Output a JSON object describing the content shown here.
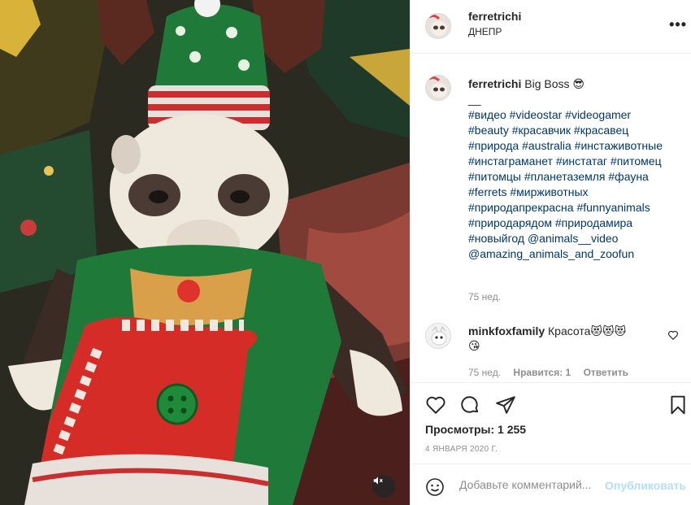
{
  "media": {
    "type": "video",
    "mute_icon": "speaker-muted-icon"
  },
  "header": {
    "username": "ferretrichi",
    "location": "ДНЕПР",
    "more_icon": "more-horizontal-icon"
  },
  "caption": {
    "username": "ferretrichi",
    "lines": [
      "Big Boss 😎",
      "__",
      "#видео #videostar #videogamer",
      "#beauty #красавчик #красавец",
      "#природа #australia #инстаживотные",
      "#инстаграманет #инстатаг #питомец",
      "#питомцы #планетаземля #фауна",
      "#ferrets #мирживотных",
      "#природапрекрасна #funnyanimals",
      "#природарядом #природамира",
      "#новыйгод @animals__video",
      "@amazing_animals_and_zoofun"
    ],
    "time": "75 нед."
  },
  "comment": {
    "username": "minkfoxfamily",
    "text": "Красота😻😻😻",
    "text2": "😘",
    "time": "75 нед.",
    "likes": "Нравится: 1",
    "reply": "Ответить"
  },
  "actions": {
    "like_icon": "heart-icon",
    "comment_icon": "comment-icon",
    "share_icon": "share-icon",
    "save_icon": "bookmark-icon",
    "views": "Просмотры: 1 255",
    "date": "4 ЯНВАРЯ 2020 Г."
  },
  "add_comment": {
    "emoji_icon": "emoji-icon",
    "placeholder": "Добавьте комментарий...",
    "publish": "Опубликовать"
  },
  "colors": {
    "link": "#00376b",
    "publish": "#b2dffc",
    "meta": "#8e8e8e",
    "border": "#efefef"
  }
}
